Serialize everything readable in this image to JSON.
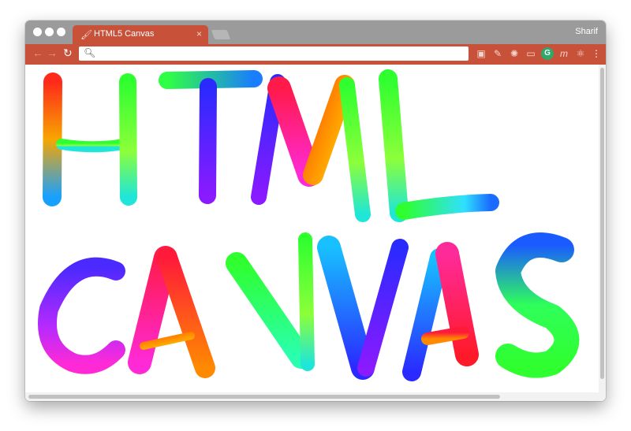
{
  "window": {
    "tab_title": "HTML5 Canvas",
    "tab_icon": "paintbrush-icon",
    "profile_name": "Sharif",
    "theme_color": "#c8513a"
  },
  "toolbar": {
    "back_icon": "arrow-left-icon",
    "forward_icon": "arrow-right-icon",
    "reload_icon": "reload-icon",
    "address_value": "",
    "search_icon": "search-icon",
    "extensions": [
      "cast-icon",
      "eyedropper-icon",
      "gear-icon",
      "window-icon",
      "grammarly-icon",
      "m-icon",
      "react-icon",
      "menu-dots-icon"
    ]
  },
  "canvas": {
    "drawing": "rainbow brush strokes",
    "drawn_text": [
      "HTML",
      "CANVAS"
    ]
  }
}
